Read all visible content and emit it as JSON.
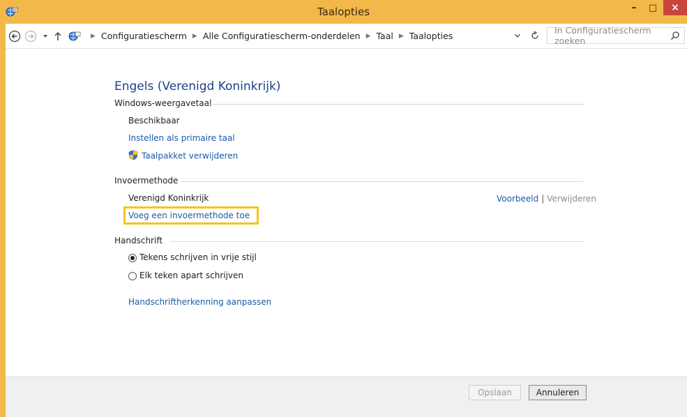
{
  "window": {
    "title": "Taalopties",
    "controls": {
      "minimize": "–",
      "maximize": "□",
      "close": "×"
    }
  },
  "addressbar": {
    "breadcrumbs": [
      "Configuratiescherm",
      "Alle Configuratiescherm-onderdelen",
      "Taal",
      "Taalopties"
    ],
    "search_placeholder": "In Configuratiescherm zoeken"
  },
  "content": {
    "heading": "Engels (Verenigd Koninkrijk)",
    "display_language": {
      "label": "Windows-weergavetaal",
      "status": "Beschikbaar",
      "set_primary": "Instellen als primaire taal",
      "remove_pack": "Taalpakket verwijderen"
    },
    "input_method": {
      "label": "Invoermethode",
      "method_name": "Verenigd Koninkrijk",
      "preview": "Voorbeeld",
      "separator": "|",
      "remove": "Verwijderen",
      "add": "Voeg een invoermethode toe"
    },
    "handwriting": {
      "label": "Handschrift",
      "option_freestyle": "Tekens schrijven in vrije stijl",
      "option_single": "Elk teken apart schrijven",
      "customize": "Handschriftherkenning aanpassen",
      "selected": "option_freestyle"
    }
  },
  "footer": {
    "save": "Opslaan",
    "cancel": "Annuleren"
  },
  "colors": {
    "frame": "#f2b84a",
    "link": "#1a5aa8",
    "heading": "#1e3f8c",
    "highlight": "#f5c518",
    "close_button": "#c9463d"
  }
}
